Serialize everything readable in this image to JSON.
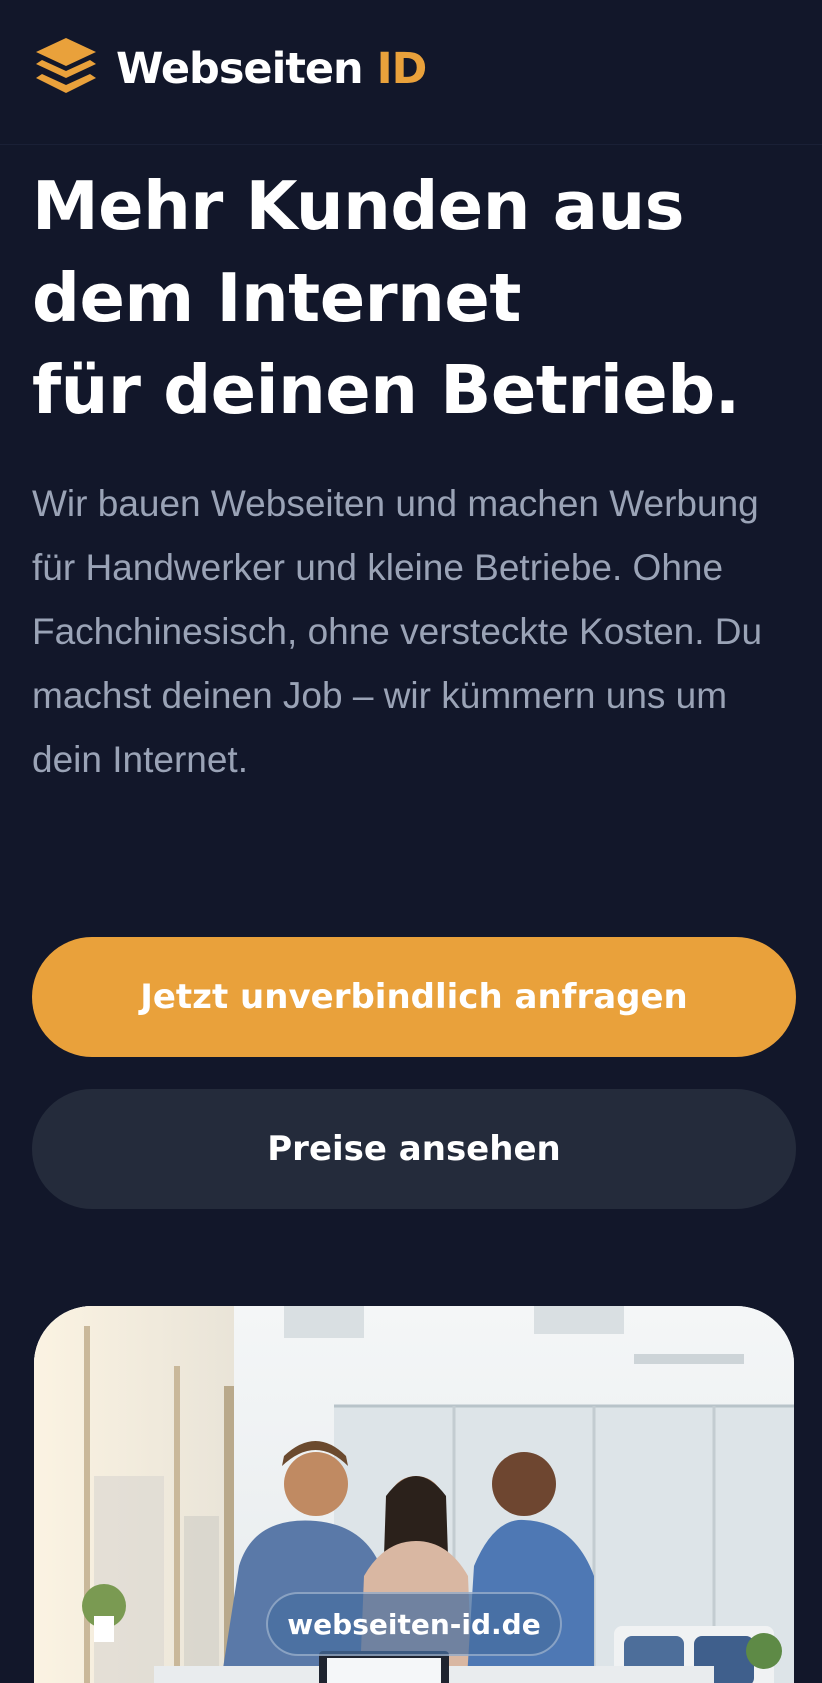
{
  "header": {
    "logo_icon": "stacked-layers-icon",
    "brand_main": "Webseiten",
    "brand_accent": "ID"
  },
  "hero": {
    "headline_lines": [
      "Mehr Kunden aus",
      "dem Internet",
      "für deinen Betrieb."
    ],
    "lead": "Wir bauen Webseiten und machen Werbung für Handwerker und kleine Betriebe. Ohne Fachchinesisch, ohne versteckte Kosten. Du machst deinen Job – wir kümmern uns um dein Internet.",
    "primary_cta": "Jetzt unverbindlich anfragen",
    "secondary_cta": "Preise ansehen",
    "image_caption": "webseiten-id.de"
  },
  "colors": {
    "background": "#12172a",
    "accent": "#e9a13b",
    "secondary_button": "#242b3b",
    "lead_text": "#9aa3b6"
  }
}
